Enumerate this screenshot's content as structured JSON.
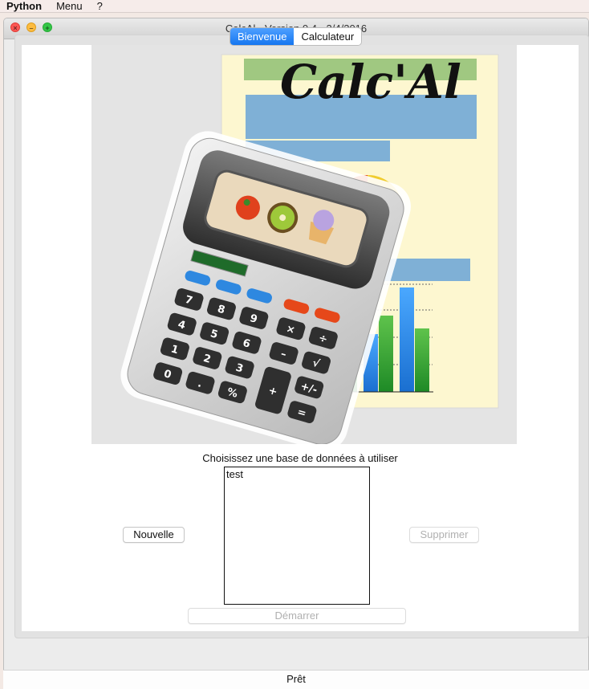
{
  "menubar": {
    "app": "Python",
    "items": [
      "Menu",
      "?"
    ]
  },
  "window": {
    "title": "CalcAl - Version 0.4 - 2/4/2016"
  },
  "tabs": [
    {
      "label": "Bienvenue",
      "active": true
    },
    {
      "label": "Calculateur",
      "active": false
    }
  ],
  "hero": {
    "logo_text": "Calc'Al",
    "calculator_keys": [
      "7",
      "8",
      "9",
      "×",
      "÷",
      "4",
      "5",
      "6",
      "–",
      "√",
      "1",
      "2",
      "3",
      "+",
      "+/-",
      "0",
      ".",
      "%",
      "="
    ]
  },
  "database": {
    "prompt": "Choisissez une base de données à utiliser",
    "items": [
      "test"
    ]
  },
  "buttons": {
    "new": "Nouvelle",
    "delete": "Supprimer",
    "start": "Démarrer"
  },
  "status": {
    "text": "Prêt"
  },
  "colors": {
    "tab_active": "#1576f0",
    "doc_bg": "#fdf7d0",
    "bar_green": "#3aa538",
    "bar_blue": "#2a82dd"
  }
}
